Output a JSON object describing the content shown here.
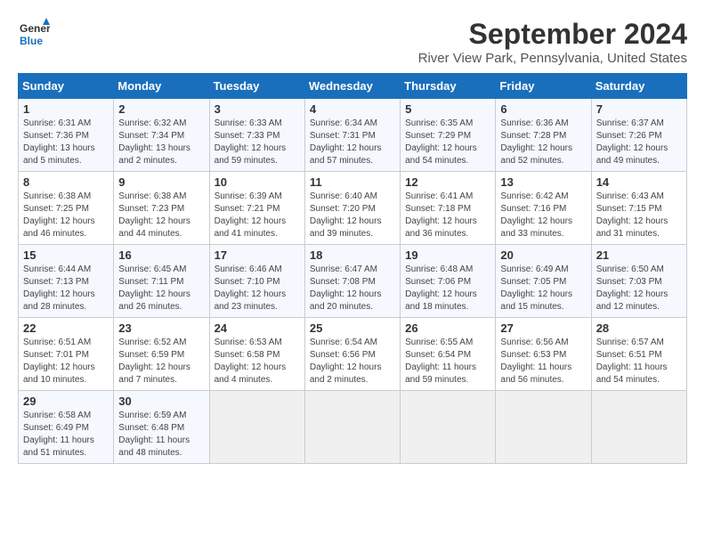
{
  "logo": {
    "line1": "General",
    "line2": "Blue"
  },
  "title": "September 2024",
  "subtitle": "River View Park, Pennsylvania, United States",
  "weekdays": [
    "Sunday",
    "Monday",
    "Tuesday",
    "Wednesday",
    "Thursday",
    "Friday",
    "Saturday"
  ],
  "weeks": [
    [
      {
        "day": "1",
        "sunrise": "6:31 AM",
        "sunset": "7:36 PM",
        "daylight": "13 hours and 5 minutes."
      },
      {
        "day": "2",
        "sunrise": "6:32 AM",
        "sunset": "7:34 PM",
        "daylight": "13 hours and 2 minutes."
      },
      {
        "day": "3",
        "sunrise": "6:33 AM",
        "sunset": "7:33 PM",
        "daylight": "12 hours and 59 minutes."
      },
      {
        "day": "4",
        "sunrise": "6:34 AM",
        "sunset": "7:31 PM",
        "daylight": "12 hours and 57 minutes."
      },
      {
        "day": "5",
        "sunrise": "6:35 AM",
        "sunset": "7:29 PM",
        "daylight": "12 hours and 54 minutes."
      },
      {
        "day": "6",
        "sunrise": "6:36 AM",
        "sunset": "7:28 PM",
        "daylight": "12 hours and 52 minutes."
      },
      {
        "day": "7",
        "sunrise": "6:37 AM",
        "sunset": "7:26 PM",
        "daylight": "12 hours and 49 minutes."
      }
    ],
    [
      {
        "day": "8",
        "sunrise": "6:38 AM",
        "sunset": "7:25 PM",
        "daylight": "12 hours and 46 minutes."
      },
      {
        "day": "9",
        "sunrise": "6:38 AM",
        "sunset": "7:23 PM",
        "daylight": "12 hours and 44 minutes."
      },
      {
        "day": "10",
        "sunrise": "6:39 AM",
        "sunset": "7:21 PM",
        "daylight": "12 hours and 41 minutes."
      },
      {
        "day": "11",
        "sunrise": "6:40 AM",
        "sunset": "7:20 PM",
        "daylight": "12 hours and 39 minutes."
      },
      {
        "day": "12",
        "sunrise": "6:41 AM",
        "sunset": "7:18 PM",
        "daylight": "12 hours and 36 minutes."
      },
      {
        "day": "13",
        "sunrise": "6:42 AM",
        "sunset": "7:16 PM",
        "daylight": "12 hours and 33 minutes."
      },
      {
        "day": "14",
        "sunrise": "6:43 AM",
        "sunset": "7:15 PM",
        "daylight": "12 hours and 31 minutes."
      }
    ],
    [
      {
        "day": "15",
        "sunrise": "6:44 AM",
        "sunset": "7:13 PM",
        "daylight": "12 hours and 28 minutes."
      },
      {
        "day": "16",
        "sunrise": "6:45 AM",
        "sunset": "7:11 PM",
        "daylight": "12 hours and 26 minutes."
      },
      {
        "day": "17",
        "sunrise": "6:46 AM",
        "sunset": "7:10 PM",
        "daylight": "12 hours and 23 minutes."
      },
      {
        "day": "18",
        "sunrise": "6:47 AM",
        "sunset": "7:08 PM",
        "daylight": "12 hours and 20 minutes."
      },
      {
        "day": "19",
        "sunrise": "6:48 AM",
        "sunset": "7:06 PM",
        "daylight": "12 hours and 18 minutes."
      },
      {
        "day": "20",
        "sunrise": "6:49 AM",
        "sunset": "7:05 PM",
        "daylight": "12 hours and 15 minutes."
      },
      {
        "day": "21",
        "sunrise": "6:50 AM",
        "sunset": "7:03 PM",
        "daylight": "12 hours and 12 minutes."
      }
    ],
    [
      {
        "day": "22",
        "sunrise": "6:51 AM",
        "sunset": "7:01 PM",
        "daylight": "12 hours and 10 minutes."
      },
      {
        "day": "23",
        "sunrise": "6:52 AM",
        "sunset": "6:59 PM",
        "daylight": "12 hours and 7 minutes."
      },
      {
        "day": "24",
        "sunrise": "6:53 AM",
        "sunset": "6:58 PM",
        "daylight": "12 hours and 4 minutes."
      },
      {
        "day": "25",
        "sunrise": "6:54 AM",
        "sunset": "6:56 PM",
        "daylight": "12 hours and 2 minutes."
      },
      {
        "day": "26",
        "sunrise": "6:55 AM",
        "sunset": "6:54 PM",
        "daylight": "11 hours and 59 minutes."
      },
      {
        "day": "27",
        "sunrise": "6:56 AM",
        "sunset": "6:53 PM",
        "daylight": "11 hours and 56 minutes."
      },
      {
        "day": "28",
        "sunrise": "6:57 AM",
        "sunset": "6:51 PM",
        "daylight": "11 hours and 54 minutes."
      }
    ],
    [
      {
        "day": "29",
        "sunrise": "6:58 AM",
        "sunset": "6:49 PM",
        "daylight": "11 hours and 51 minutes."
      },
      {
        "day": "30",
        "sunrise": "6:59 AM",
        "sunset": "6:48 PM",
        "daylight": "11 hours and 48 minutes."
      },
      null,
      null,
      null,
      null,
      null
    ]
  ],
  "labels": {
    "sunrise": "Sunrise:",
    "sunset": "Sunset:",
    "daylight": "Daylight:"
  },
  "colors": {
    "header_bg": "#1a6fbc",
    "odd_row": "#f5f8ff",
    "even_row": "#ffffff",
    "empty_cell": "#f0f0f0"
  }
}
